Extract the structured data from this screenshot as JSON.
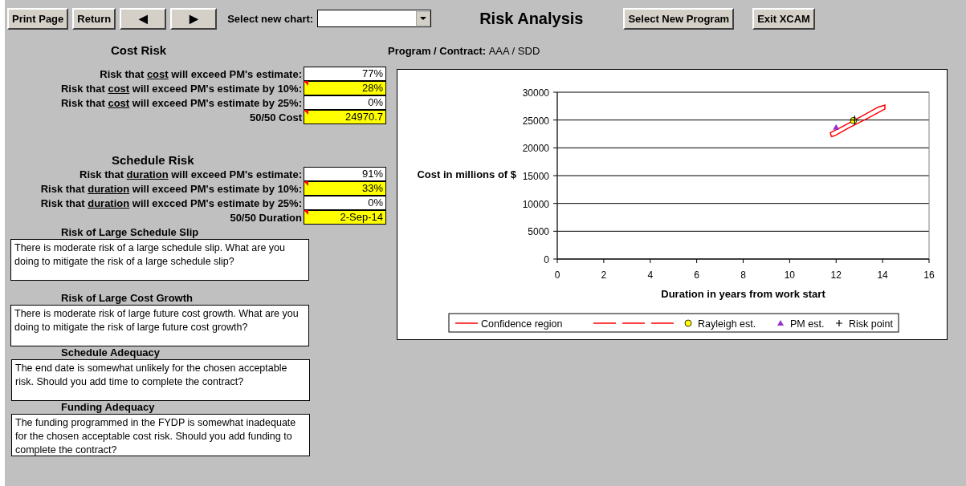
{
  "toolbar": {
    "buttons": [
      {
        "label": "Print Page",
        "kind": "text"
      },
      {
        "label": "Return",
        "kind": "text"
      },
      {
        "label": "◀",
        "kind": "arrow"
      },
      {
        "label": "▶",
        "kind": "arrow"
      }
    ],
    "chart_select": {
      "label": "Select new chart:"
    },
    "title": "Risk Analysis",
    "right_buttons": [
      "Select New Program",
      "Exit XCAM"
    ]
  },
  "program": {
    "label": "Program / Contract:",
    "value": "AAA / SDD"
  },
  "sections": [
    {
      "title": "Cost Risk",
      "rows": [
        {
          "label": "Risk that ",
          "underlined": "cost",
          "label_end": " will exceed PM's estimate:",
          "value": "77%",
          "highlighted": false,
          "comment": false
        },
        {
          "label": "Risk that ",
          "underlined": "cost",
          "label_end": " will exceed PM's estimate by 10%:",
          "value": "28%",
          "highlighted": true,
          "comment": true
        },
        {
          "label": "Risk that ",
          "underlined": "cost",
          "label_end": " will exceed PM's estimate by 25%:",
          "value": "0%",
          "highlighted": false,
          "comment": false
        },
        {
          "label": "50/50 Cost",
          "value": "24970.7",
          "highlighted": true,
          "comment": true
        }
      ]
    },
    {
      "title": "Schedule Risk",
      "rows": [
        {
          "label": "Risk that ",
          "underlined": "duration",
          "label_end": " will exceed PM's estimate:",
          "value": "91%",
          "highlighted": false,
          "comment": false
        },
        {
          "label": "Risk that ",
          "underlined": "duration",
          "label_end": " will exceed PM's estimate by 10%:",
          "value": "33%",
          "highlighted": true,
          "comment": true
        },
        {
          "label": "Risk that ",
          "underlined": "duration",
          "label_end": " will excced PM's estimate by 25%:",
          "value": "0%",
          "highlighted": false,
          "comment": false
        },
        {
          "label": "50/50 Duration",
          "value": "2-Sep-14",
          "highlighted": true,
          "comment": true
        }
      ]
    }
  ],
  "messages": [
    {
      "title": "Risk of Large Schedule Slip",
      "text": "There is moderate risk of a large schedule slip. What are you doing to mitigate the risk of a large schedule slip?"
    },
    {
      "title": "Risk of Large Cost Growth",
      "text": "There is moderate risk of large future cost growth. What are you doing to mitigate the risk of large future cost growth?"
    },
    {
      "title": "Schedule Adequacy",
      "text": "The end date is somewhat unlikely for the chosen acceptable risk. Should you add time to complete the contract?"
    },
    {
      "title": "Funding Adequacy",
      "text": "The funding programmed in the FYDP is somewhat inadequate for the chosen acceptable cost risk. Should you add funding to complete the contract?"
    }
  ],
  "chart_data": {
    "type": "scatter",
    "grid": true,
    "legend": true,
    "xlabel": "Duration in years from work start",
    "ylabel": "Cost in millions of $",
    "xlim": [
      0,
      16
    ],
    "ylim": [
      0,
      30000
    ],
    "xticks": [
      0,
      2,
      4,
      6,
      8,
      10,
      12,
      14,
      16
    ],
    "yticks": [
      0,
      5000,
      10000,
      15000,
      20000,
      25000,
      30000
    ],
    "series": [
      {
        "name": "Confidence region",
        "color": "#ff0000",
        "marker": "none"
      },
      {
        "color": "#ff0000"
      },
      {
        "color": "#ff0000"
      },
      {
        "color": "#ff0000"
      },
      {
        "name": "Rayleigh est.",
        "color": "#ffff00",
        "marker": "circle",
        "x": [
          12.75
        ],
        "values": [
          24900
        ]
      },
      {
        "name": "PM est.",
        "color": "#9933cc",
        "marker": "triangle",
        "x": [
          12
        ],
        "values": [
          23700
        ]
      },
      {
        "name": "Risk point",
        "color": "#000000",
        "marker": "plus",
        "x": [
          12.8
        ],
        "values": [
          25000
        ]
      }
    ]
  }
}
